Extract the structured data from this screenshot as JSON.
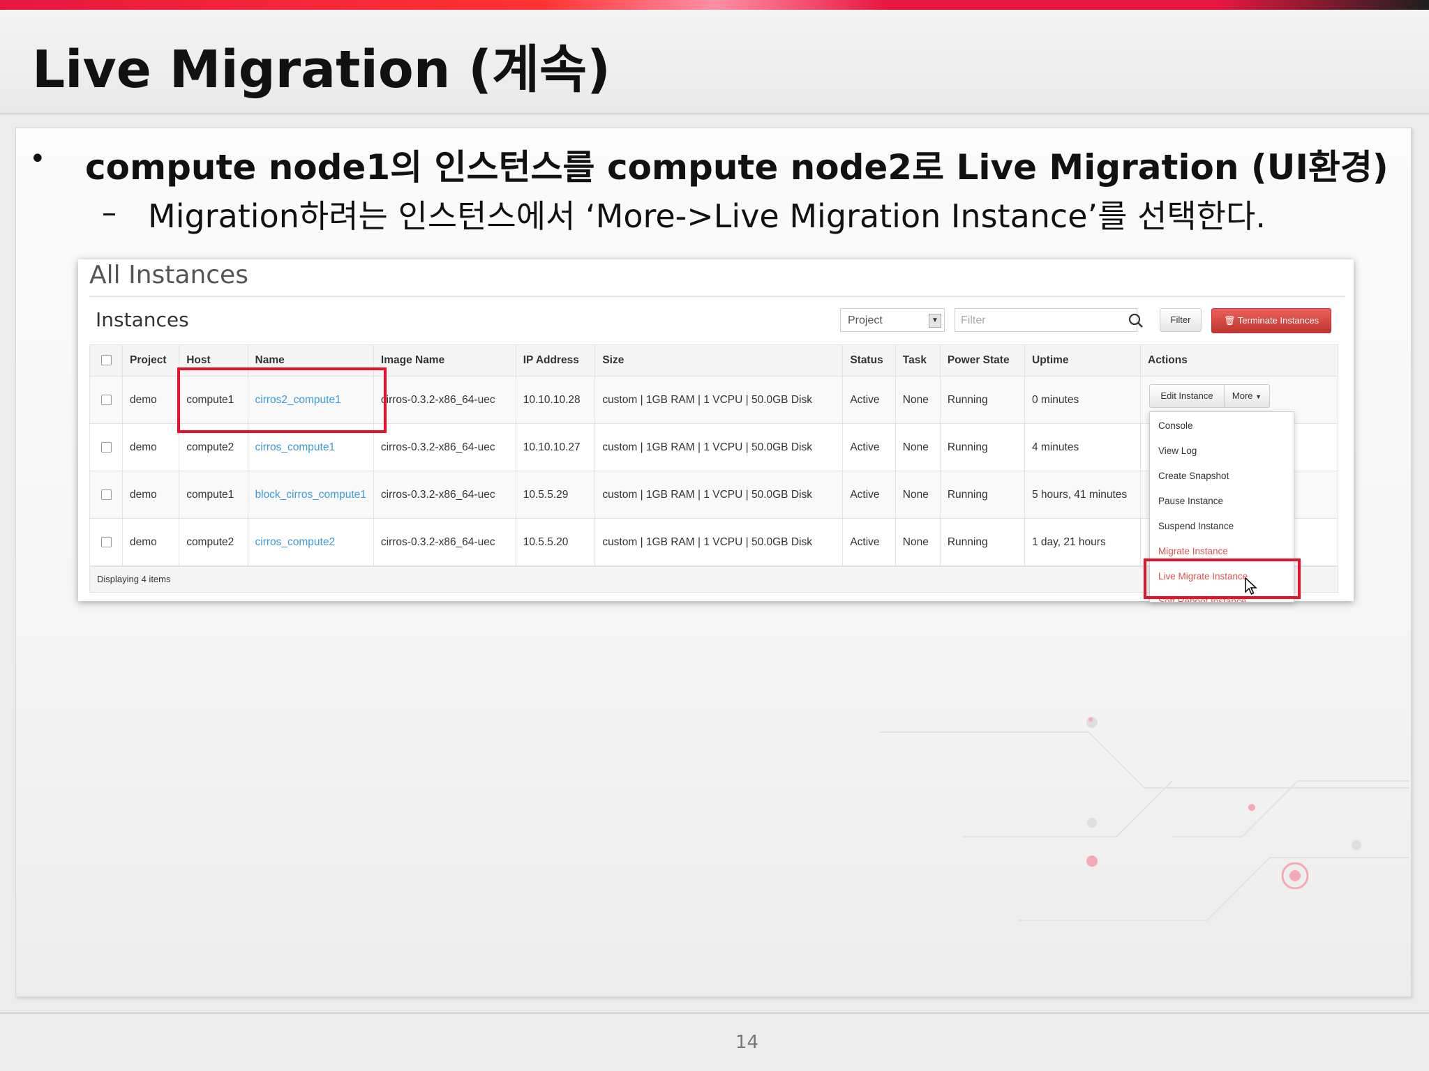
{
  "slide": {
    "title": "Live Migration (계속)",
    "bullet_main": "compute node1의 인스턴스를 compute node2로 Live Migration (UI환경)",
    "bullet_sub": "Migration하려는 인스턴스에서 ‘More->Live Migration Instance’를 선택한다.",
    "page_number": "14"
  },
  "screenshot": {
    "page_title": "All Instances",
    "table_title": "Instances",
    "project_select": "Project",
    "filter_placeholder": "Filter",
    "filter_button": "Filter",
    "terminate_button": "Terminate Instances",
    "columns": [
      "Project",
      "Host",
      "Name",
      "Image Name",
      "IP Address",
      "Size",
      "Status",
      "Task",
      "Power State",
      "Uptime",
      "Actions"
    ],
    "rows": [
      {
        "project": "demo",
        "host": "compute1",
        "name": "cirros2_compute1",
        "image": "cirros-0.3.2-x86_64-uec",
        "ip": "10.10.10.28",
        "size": "custom | 1GB RAM | 1 VCPU | 50.0GB Disk",
        "status": "Active",
        "task": "None",
        "power": "Running",
        "uptime": "0 minutes"
      },
      {
        "project": "demo",
        "host": "compute2",
        "name": "cirros_compute1",
        "image": "cirros-0.3.2-x86_64-uec",
        "ip": "10.10.10.27",
        "size": "custom | 1GB RAM | 1 VCPU | 50.0GB Disk",
        "status": "Active",
        "task": "None",
        "power": "Running",
        "uptime": "4 minutes"
      },
      {
        "project": "demo",
        "host": "compute1",
        "name": "block_cirros_compute1",
        "image": "cirros-0.3.2-x86_64-uec",
        "ip": "10.5.5.29",
        "size": "custom | 1GB RAM | 1 VCPU | 50.0GB Disk",
        "status": "Active",
        "task": "None",
        "power": "Running",
        "uptime": "5 hours, 41 minutes"
      },
      {
        "project": "demo",
        "host": "compute2",
        "name": "cirros_compute2",
        "image": "cirros-0.3.2-x86_64-uec",
        "ip": "10.5.5.20",
        "size": "custom | 1GB RAM | 1 VCPU | 50.0GB Disk",
        "status": "Active",
        "task": "None",
        "power": "Running",
        "uptime": "1 day, 21 hours"
      }
    ],
    "footer": "Displaying 4 items",
    "edit_button": "Edit Instance",
    "more_button": "More",
    "menu": [
      "Console",
      "View Log",
      "Create Snapshot",
      "Pause Instance",
      "Suspend Instance",
      "Migrate Instance",
      "Live Migrate Instance",
      "Soft Reboot Instance"
    ]
  },
  "colors": {
    "accent": "#e8102a",
    "link": "#3b9bd6",
    "danger": "#d9534f"
  }
}
